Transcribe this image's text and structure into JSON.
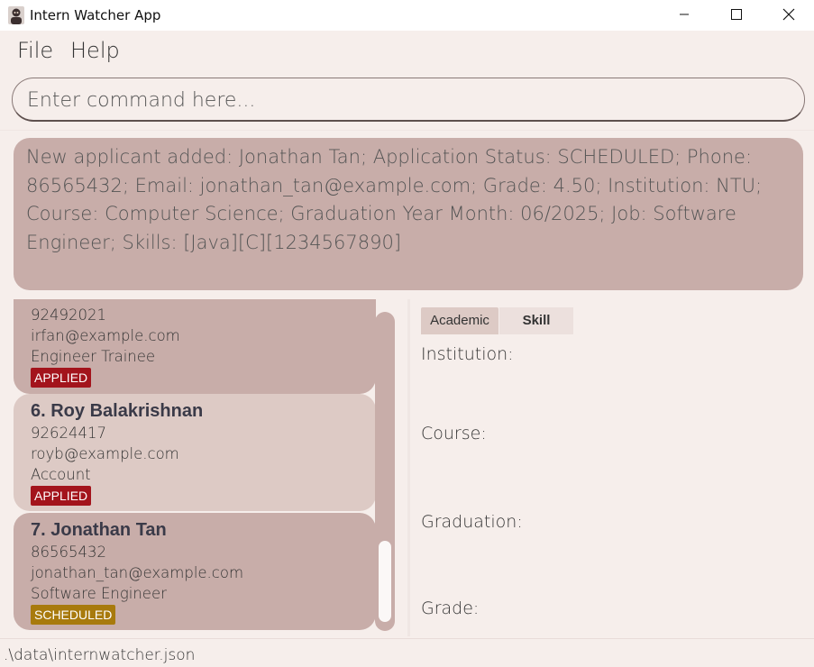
{
  "window": {
    "title": "Intern Watcher App",
    "icon": "app-person-icon"
  },
  "menu": {
    "file": "File",
    "help": "Help"
  },
  "command": {
    "placeholder": "Enter command here...",
    "value": ""
  },
  "result": {
    "message": "New applicant added: Jonathan Tan; Application Status: SCHEDULED; Phone: 86565432; Email: jonathan_tan@example.com; Grade: 4.50; Institution: NTU; Course: Computer Science; Graduation Year Month: 06/2025; Job: Software Engineer; Skills: [Java][C][1234567890]"
  },
  "applicants": [
    {
      "name": "",
      "phone": "92492021",
      "email": "irfan@example.com",
      "job": "Engineer Trainee",
      "status": "APPLIED"
    },
    {
      "name": "6.  Roy Balakrishnan",
      "phone": "92624417",
      "email": "royb@example.com",
      "job": "Account",
      "status": "APPLIED"
    },
    {
      "name": "7.  Jonathan Tan",
      "phone": "86565432",
      "email": "jonathan_tan@example.com",
      "job": "Software Engineer",
      "status": "SCHEDULED"
    }
  ],
  "details": {
    "tabs": [
      "Academic",
      "Skill"
    ],
    "active_tab": "Academic",
    "labels": {
      "institution": "Institution:",
      "course": "Course:",
      "graduation": "Graduation:",
      "grade": "Grade:"
    }
  },
  "status_bar": {
    "path": ".\\data\\internwatcher.json"
  },
  "colors": {
    "background": "#f6eeeb",
    "card": "#c8ada9",
    "card_selected": "#ddcac5",
    "applied": "#a3141c",
    "scheduled": "#a87a0d"
  }
}
